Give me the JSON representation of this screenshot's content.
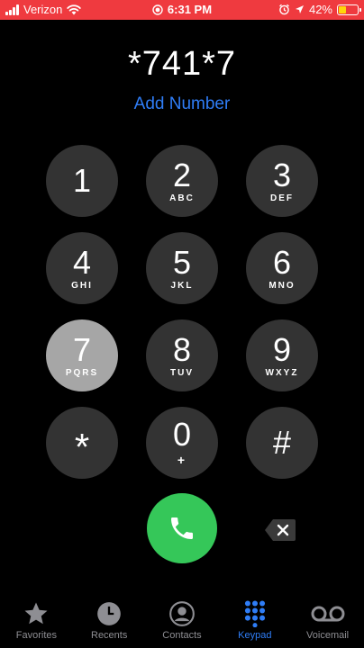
{
  "status_bar": {
    "carrier": "Verizon",
    "time": "6:31 PM",
    "battery": "42%",
    "battery_level": 0.42,
    "background_color": "#ef3a3f"
  },
  "dial": {
    "number": "*741*7",
    "add_number_label": "Add Number"
  },
  "keypad": {
    "keys": [
      {
        "digit": "1",
        "letters": ""
      },
      {
        "digit": "2",
        "letters": "ABC"
      },
      {
        "digit": "3",
        "letters": "DEF"
      },
      {
        "digit": "4",
        "letters": "GHI"
      },
      {
        "digit": "5",
        "letters": "JKL"
      },
      {
        "digit": "6",
        "letters": "MNO"
      },
      {
        "digit": "7",
        "letters": "PQRS"
      },
      {
        "digit": "8",
        "letters": "TUV"
      },
      {
        "digit": "9",
        "letters": "WXYZ"
      },
      {
        "digit": "*",
        "letters": ""
      },
      {
        "digit": "0",
        "letters": "+"
      },
      {
        "digit": "#",
        "letters": ""
      }
    ],
    "pressed_key": "7",
    "call_color": "#35c759"
  },
  "tabs": [
    {
      "label": "Favorites",
      "icon": "star-icon",
      "active": false
    },
    {
      "label": "Recents",
      "icon": "clock-icon",
      "active": false
    },
    {
      "label": "Contacts",
      "icon": "person-icon",
      "active": false
    },
    {
      "label": "Keypad",
      "icon": "keypad-icon",
      "active": true
    },
    {
      "label": "Voicemail",
      "icon": "voicemail-icon",
      "active": false
    }
  ],
  "accent_color": "#2f7df6"
}
